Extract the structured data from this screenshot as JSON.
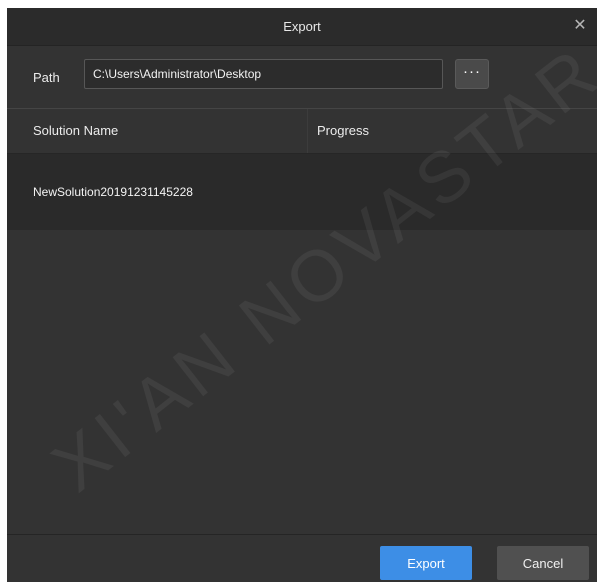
{
  "dialog": {
    "title": "Export",
    "close_icon": "close-icon"
  },
  "path": {
    "label": "Path",
    "value": "C:\\Users\\Administrator\\Desktop",
    "browse_label": "···"
  },
  "table": {
    "columns": [
      "Solution Name",
      "Progress"
    ],
    "rows": [
      {
        "name": "NewSolution20191231145228",
        "progress": ""
      }
    ]
  },
  "footer": {
    "export_label": "Export",
    "cancel_label": "Cancel"
  },
  "watermark": "XI'AN NOVASTAR",
  "colors": {
    "background": "#333333",
    "titlebar": "#2b2b2b",
    "row": "#2a2a2a",
    "accent": "#3d8ee6",
    "cancel": "#505050"
  }
}
